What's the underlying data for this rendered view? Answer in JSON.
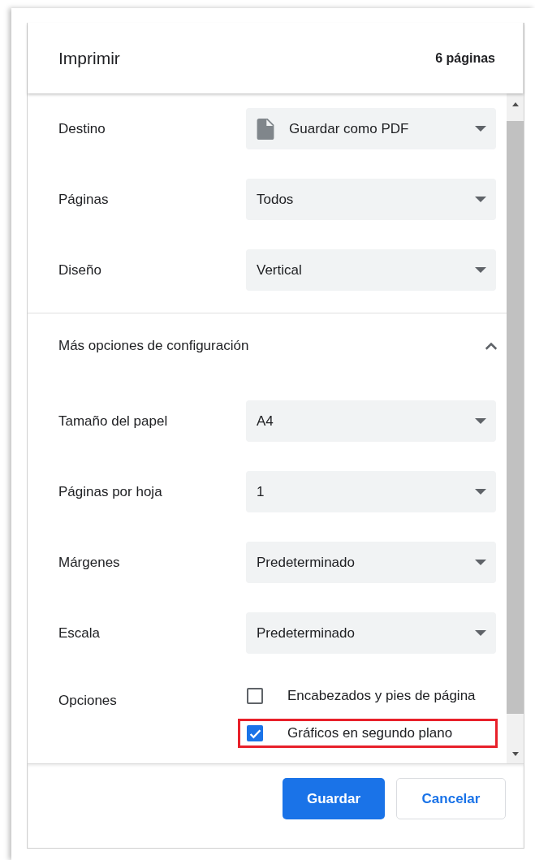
{
  "header": {
    "title": "Imprimir",
    "page_count": "6 páginas"
  },
  "settings": [
    {
      "label": "Destino",
      "value": "Guardar como PDF",
      "kind": "destination"
    },
    {
      "label": "Páginas",
      "value": "Todos",
      "kind": "plain"
    },
    {
      "label": "Diseño",
      "value": "Vertical",
      "kind": "plain"
    }
  ],
  "more_settings": {
    "label": "Más opciones de configuración",
    "expanded": true
  },
  "advanced_settings": [
    {
      "label": "Tamaño del papel",
      "value": "A4"
    },
    {
      "label": "Páginas por hoja",
      "value": "1"
    },
    {
      "label": "Márgenes",
      "value": "Predeterminado"
    },
    {
      "label": "Escala",
      "value": "Predeterminado"
    }
  ],
  "options": {
    "label": "Opciones",
    "items": [
      {
        "label": "Encabezados y pies de página",
        "checked": false,
        "highlighted": false
      },
      {
        "label": "Gráficos en segundo plano",
        "checked": true,
        "highlighted": true
      }
    ]
  },
  "buttons": [
    {
      "label": "Guardar",
      "kind": "primary"
    },
    {
      "label": "Cancelar",
      "kind": "secondary"
    }
  ]
}
